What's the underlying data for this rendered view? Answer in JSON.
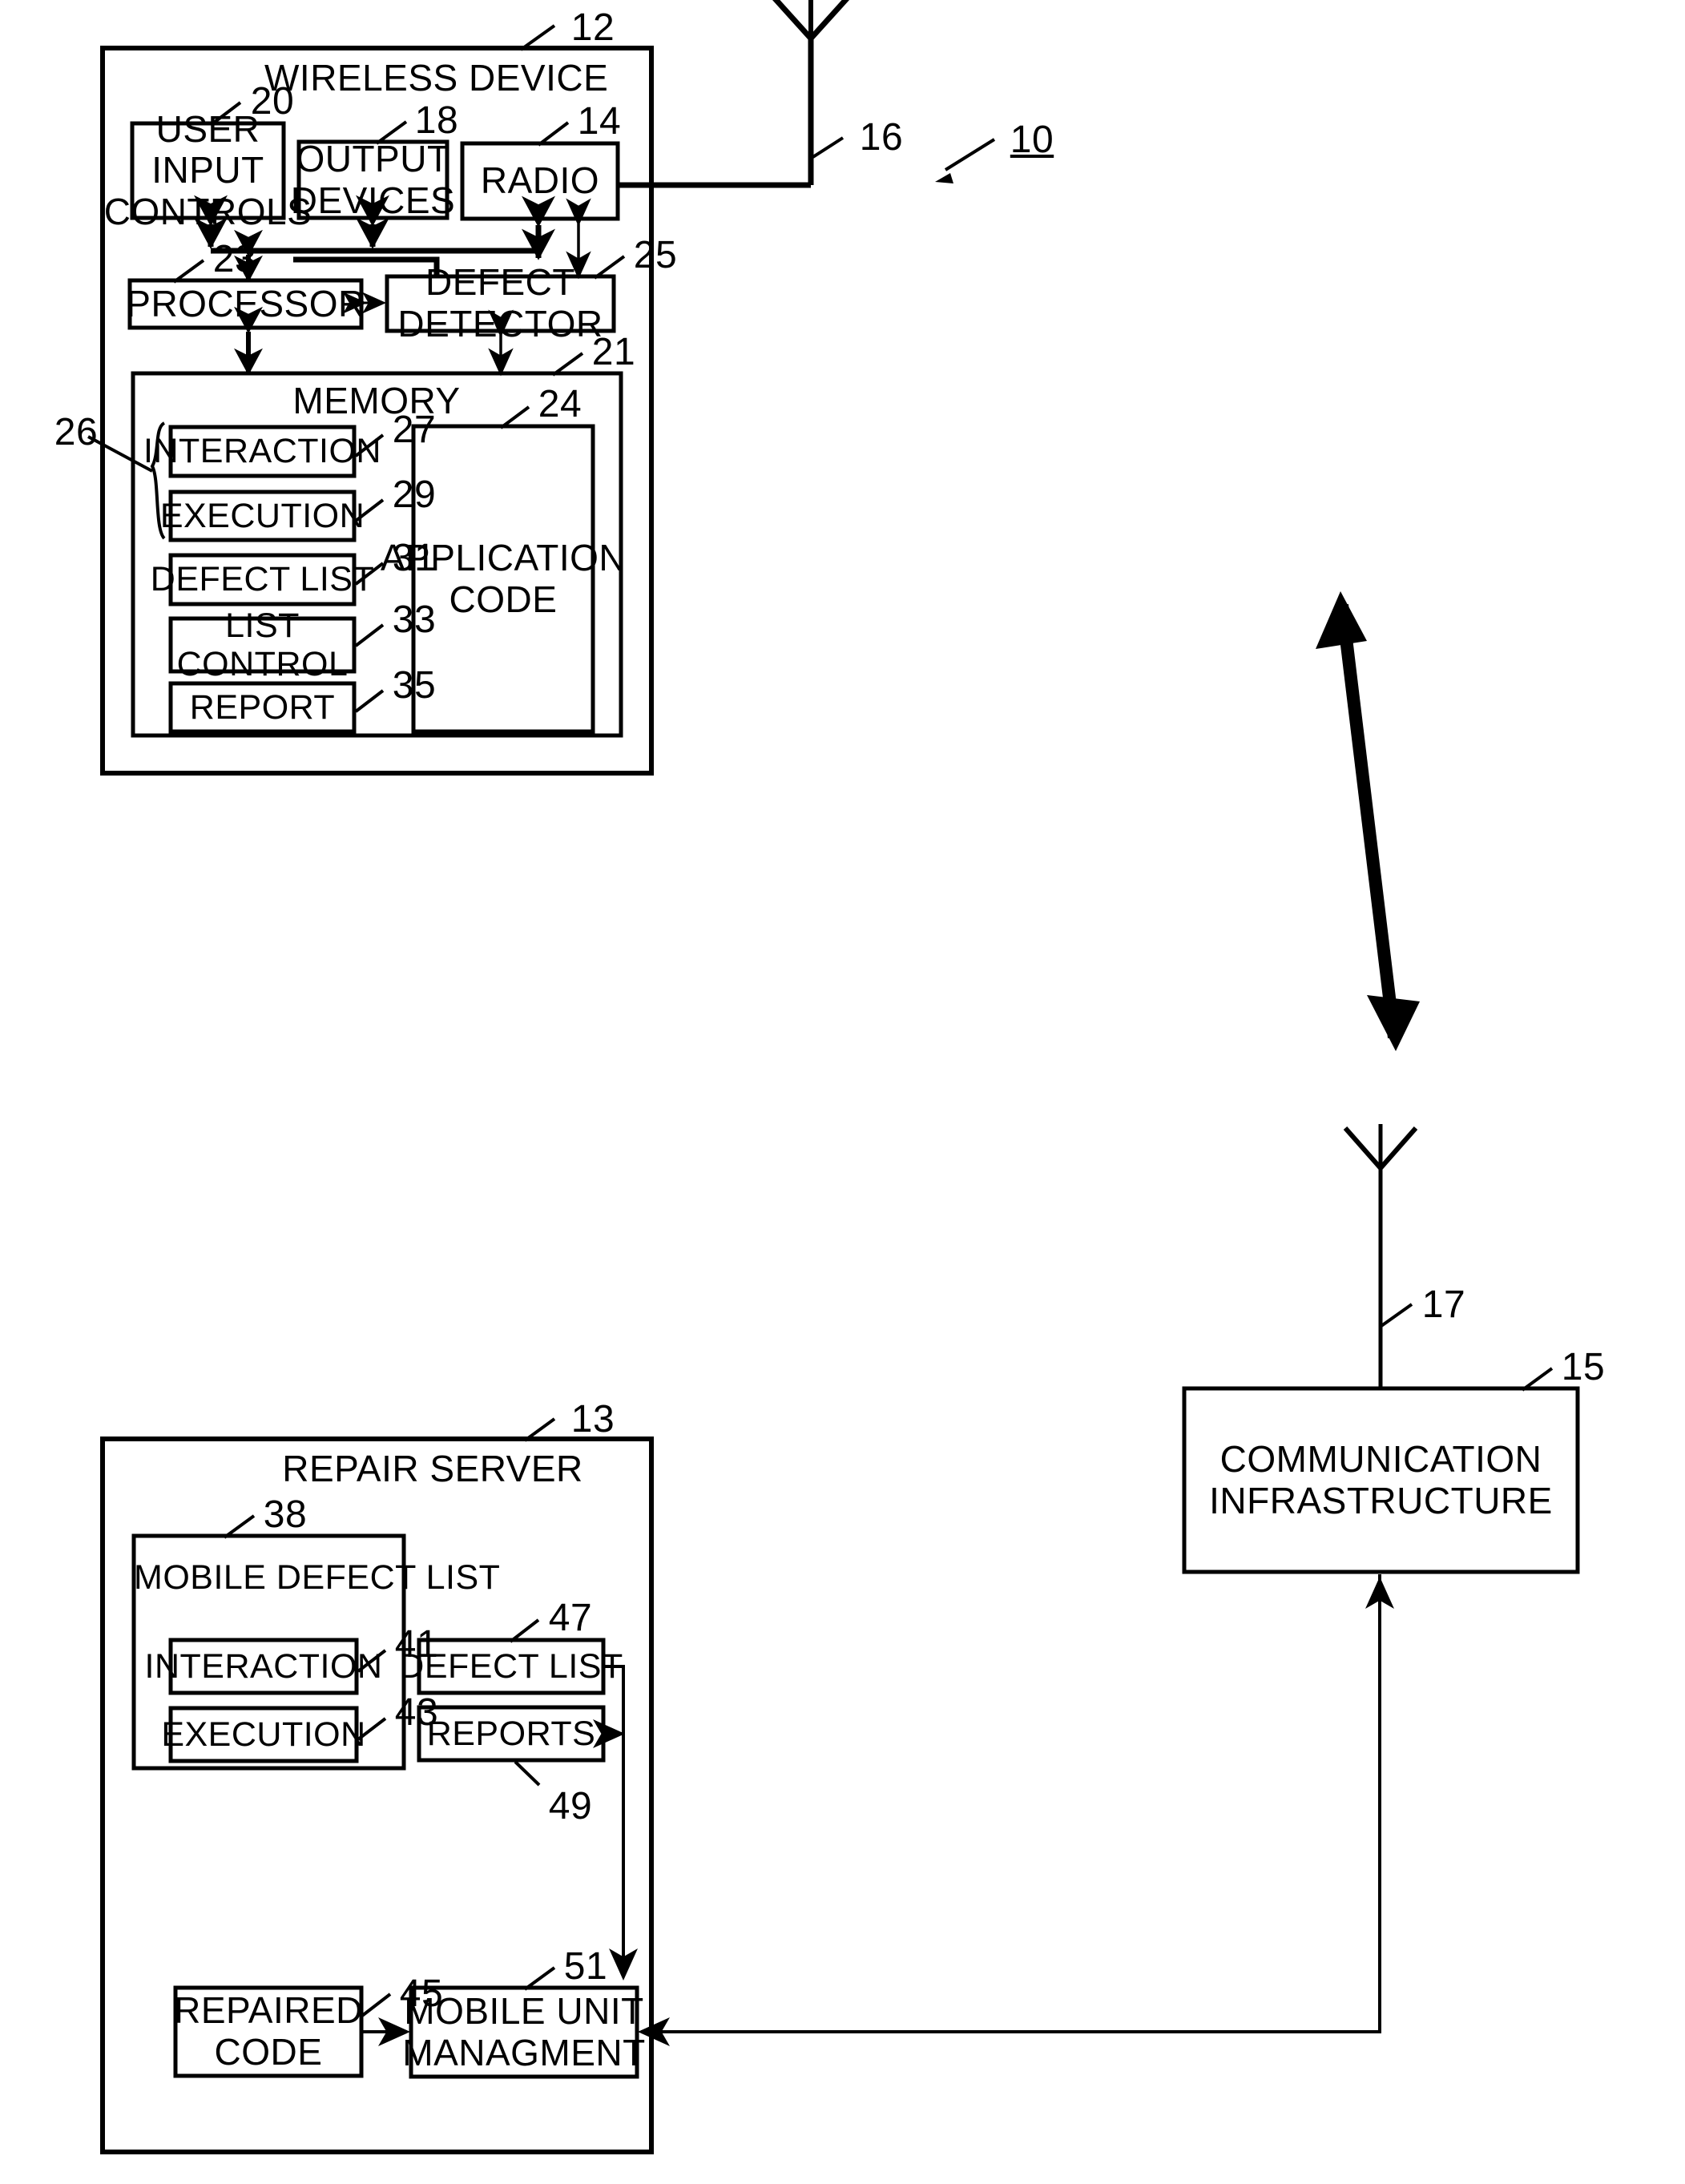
{
  "figure": {
    "system_ref": "10",
    "wireless_device": {
      "title": "WIRELESS DEVICE",
      "ref": "12",
      "antenna_ref": "16",
      "blocks": [
        {
          "id": "user_input_controls",
          "label": "USER\nINPUT\nCONTROLS",
          "ref": "20"
        },
        {
          "id": "output_devices",
          "label": "OUTPUT\nDEVICES",
          "ref": "18"
        },
        {
          "id": "radio",
          "label": "RADIO",
          "ref": "14"
        },
        {
          "id": "processor",
          "label": "PROCESSOR",
          "ref": "23"
        },
        {
          "id": "defect_detector",
          "label": "DEFECT\nDETECTOR",
          "ref": "25"
        }
      ],
      "memory": {
        "label": "MEMORY",
        "ref": "21",
        "brace_ref": "26",
        "items": [
          {
            "id": "interaction",
            "label": "INTERACTION",
            "ref": "27"
          },
          {
            "id": "execution",
            "label": "EXECUTION",
            "ref": "29"
          },
          {
            "id": "defect_list",
            "label": "DEFECT LIST",
            "ref": "31"
          },
          {
            "id": "list_control",
            "label": "LIST\nCONTROL",
            "ref": "33"
          },
          {
            "id": "report",
            "label": "REPORT",
            "ref": "35"
          }
        ],
        "application_code": {
          "label": "APPLICATION\nCODE",
          "ref": "24"
        }
      }
    },
    "communication_infrastructure": {
      "label": "COMMUNICATION\nINFRASTRUCTURE",
      "ref": "15",
      "antenna_ref": "17"
    },
    "repair_server": {
      "title": "REPAIR SERVER",
      "ref": "13",
      "mobile_defect_list": {
        "label": "MOBILE DEFECT LIST",
        "ref": "38",
        "items": [
          {
            "id": "interaction",
            "label": "INTERACTION",
            "ref": "41"
          },
          {
            "id": "execution",
            "label": "EXECUTION",
            "ref": "43"
          }
        ]
      },
      "blocks": [
        {
          "id": "defect_list",
          "label": "DEFECT LIST",
          "ref": "47"
        },
        {
          "id": "reports",
          "label": "REPORTS",
          "ref": "49"
        },
        {
          "id": "repaired_code",
          "label": "REPAIRED\nCODE",
          "ref": "45"
        },
        {
          "id": "mobile_unit_management",
          "label": "MOBILE UNIT\nMANAGMENT",
          "ref": "51"
        }
      ]
    }
  },
  "style": {
    "ink": "#000000",
    "paper": "#ffffff"
  }
}
